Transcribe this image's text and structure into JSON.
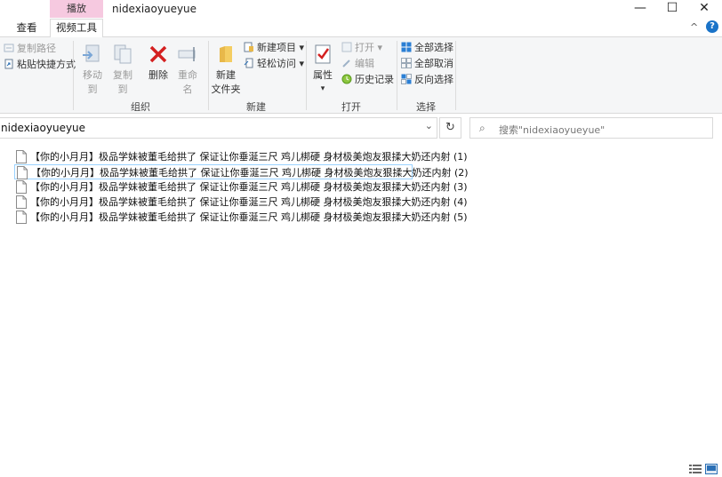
{
  "window": {
    "context_tab": "播放",
    "title": "nidexiaoyueyue",
    "minimize": "—",
    "maximize": "☐",
    "close": "✕"
  },
  "ribbon_tabs": {
    "view": "查看",
    "video_tools": "视频工具",
    "collapse": "^",
    "help": "?"
  },
  "ribbon": {
    "clipboard": {
      "copy_path": "复制路径",
      "paste_shortcut": "粘贴快捷方式"
    },
    "organize": {
      "label": "组织",
      "move_to": "移动到",
      "copy_to": "复制到",
      "delete": "删除",
      "rename": "重命名"
    },
    "new": {
      "label": "新建",
      "new_folder_line1": "新建",
      "new_folder_line2": "文件夹",
      "new_item": "新建项目",
      "easy_access": "轻松访问"
    },
    "open": {
      "label": "打开",
      "properties": "属性",
      "open": "打开",
      "edit": "编辑",
      "history": "历史记录"
    },
    "select": {
      "label": "选择",
      "select_all": "全部选择",
      "select_none": "全部取消",
      "invert": "反向选择"
    }
  },
  "address": {
    "path": "nidexiaoyueyue",
    "search_placeholder": "搜索\"nidexiaoyueyue\""
  },
  "files": [
    {
      "name": "【你的小月月】极品学妹被董毛给拱了 保证让你垂涎三尺 鸡儿梆硬 身材极美炮友狠揉大奶还内射 (1)"
    },
    {
      "name": "【你的小月月】极品学妹被董毛给拱了 保证让你垂涎三尺 鸡儿梆硬 身材极美炮友狠揉大奶还内射 (2)"
    },
    {
      "name": "【你的小月月】极品学妹被董毛给拱了 保证让你垂涎三尺 鸡儿梆硬 身材极美炮友狠揉大奶还内射 (3)"
    },
    {
      "name": "【你的小月月】极品学妹被董毛给拱了 保证让你垂涎三尺 鸡儿梆硬 身材极美炮友狠揉大奶还内射 (4)"
    },
    {
      "name": "【你的小月月】极品学妹被董毛给拱了 保证让你垂涎三尺 鸡儿梆硬 身材极美炮友狠揉大奶还内射 (5)"
    }
  ],
  "colors": {
    "context_tab": "#f6c9e0",
    "delete_red": "#d42020",
    "accent_blue": "#1a73c8",
    "selection_border": "#99d1ff"
  }
}
